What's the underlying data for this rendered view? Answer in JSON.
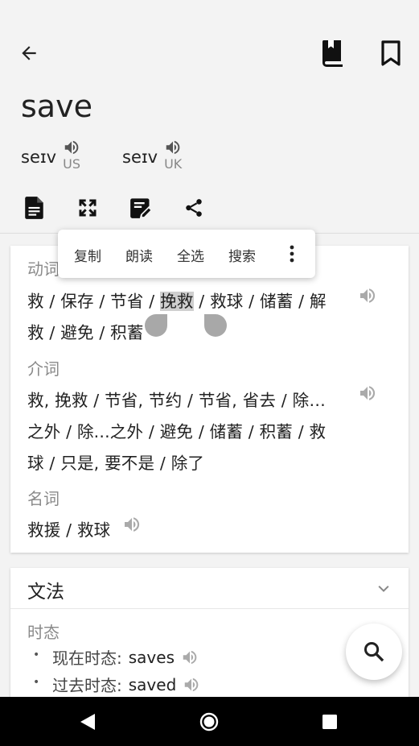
{
  "header": {
    "word": "save",
    "pronunciations": [
      {
        "ipa": "seɪv",
        "region": "US"
      },
      {
        "ipa": "seɪv",
        "region": "UK"
      }
    ]
  },
  "context_menu": {
    "items": [
      "复制",
      "朗读",
      "全选",
      "搜索"
    ]
  },
  "definitions": {
    "verb": {
      "pos": "动词",
      "before_highlight": "救 / 保存 / 节省 / ",
      "highlight": "挽救",
      "after_highlight": " / 救球 / 储蓄 / 解",
      "line2": "救 / 避免 / 积蓄"
    },
    "preposition": {
      "pos": "介词",
      "line1": "救, 挽救 / 节省, 节约 / 节省, 省去 / 除…",
      "line2": "之外 / 除...之外 / 避免 / 储蓄 / 积蓄 / 救",
      "line3": "球 / 只是, 要不是 / 除了"
    },
    "noun": {
      "pos": "名词",
      "line1": "救援 / 救球"
    }
  },
  "grammar": {
    "title": "文法",
    "section": "时态",
    "items": [
      {
        "label": "现在时态:",
        "value": "saves"
      },
      {
        "label": "过去时态:",
        "value": "saved"
      }
    ]
  }
}
